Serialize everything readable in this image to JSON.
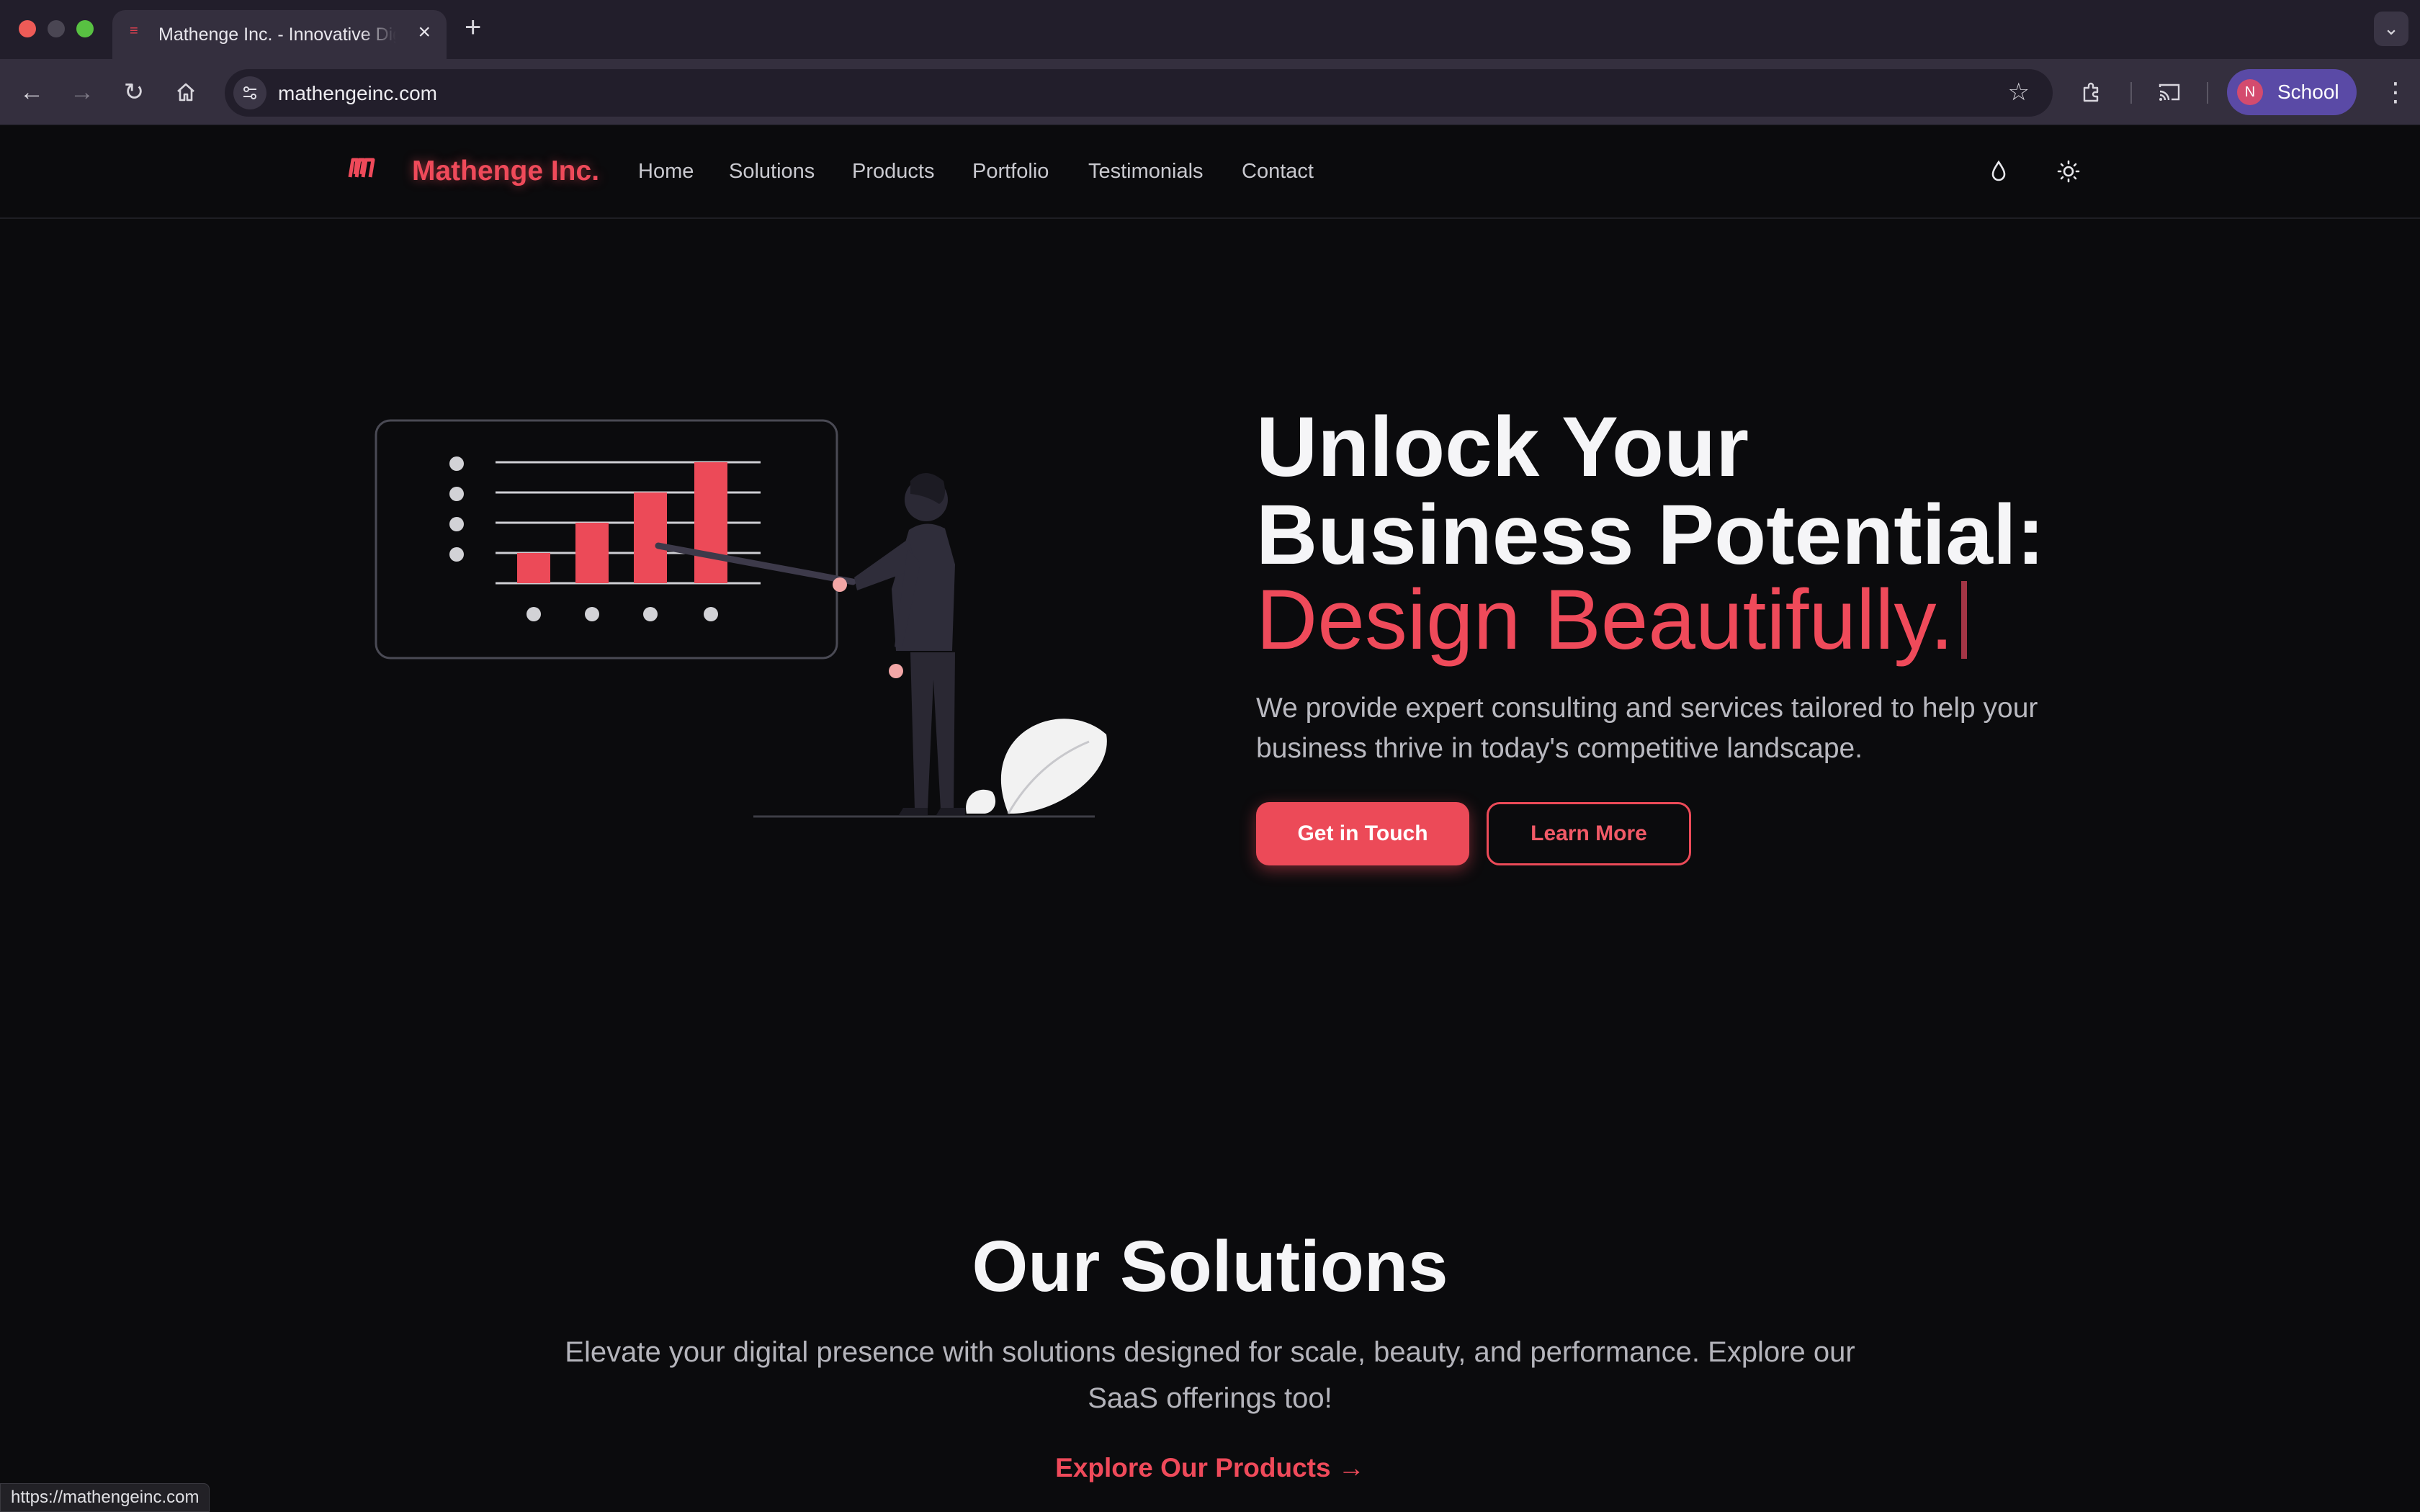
{
  "browser": {
    "tab_title": "Mathenge Inc. - Innovative Digital Solutions",
    "url": "mathengeinc.com",
    "profile_initial": "N",
    "profile_name": "School",
    "status_url": "https://mathengeinc.com"
  },
  "header": {
    "brand": "Mathenge Inc.",
    "nav": [
      "Home",
      "Solutions",
      "Products",
      "Portfolio",
      "Testimonials",
      "Contact"
    ]
  },
  "hero": {
    "title_line1": "Unlock Your",
    "title_line2": "Business Potential:",
    "title_accent": "Design Beautifully.",
    "description": "We provide expert consulting and services tailored to help your business thrive in today's competitive landscape.",
    "primary_button": "Get in Touch",
    "secondary_button": "Learn More"
  },
  "solutions": {
    "title": "Our Solutions",
    "description": "Elevate your digital presence with solutions designed for scale, beauty, and performance. Explore our SaaS offerings too!",
    "link": "Explore Our Products →"
  },
  "colors": {
    "accent": "#ec4a58",
    "page_bg": "#0b0b0d",
    "browser_frame": "#221e2b",
    "profile_chip": "#5a4aa6"
  },
  "icons": [
    "close-icon",
    "plus-icon",
    "back-arrow-icon",
    "forward-arrow-icon",
    "reload-icon",
    "home-icon",
    "site-settings-icon",
    "star-icon",
    "extensions-icon",
    "cast-icon",
    "kebab-menu-icon",
    "chevron-down-icon",
    "logo-icon",
    "drop-icon",
    "sun-icon"
  ]
}
